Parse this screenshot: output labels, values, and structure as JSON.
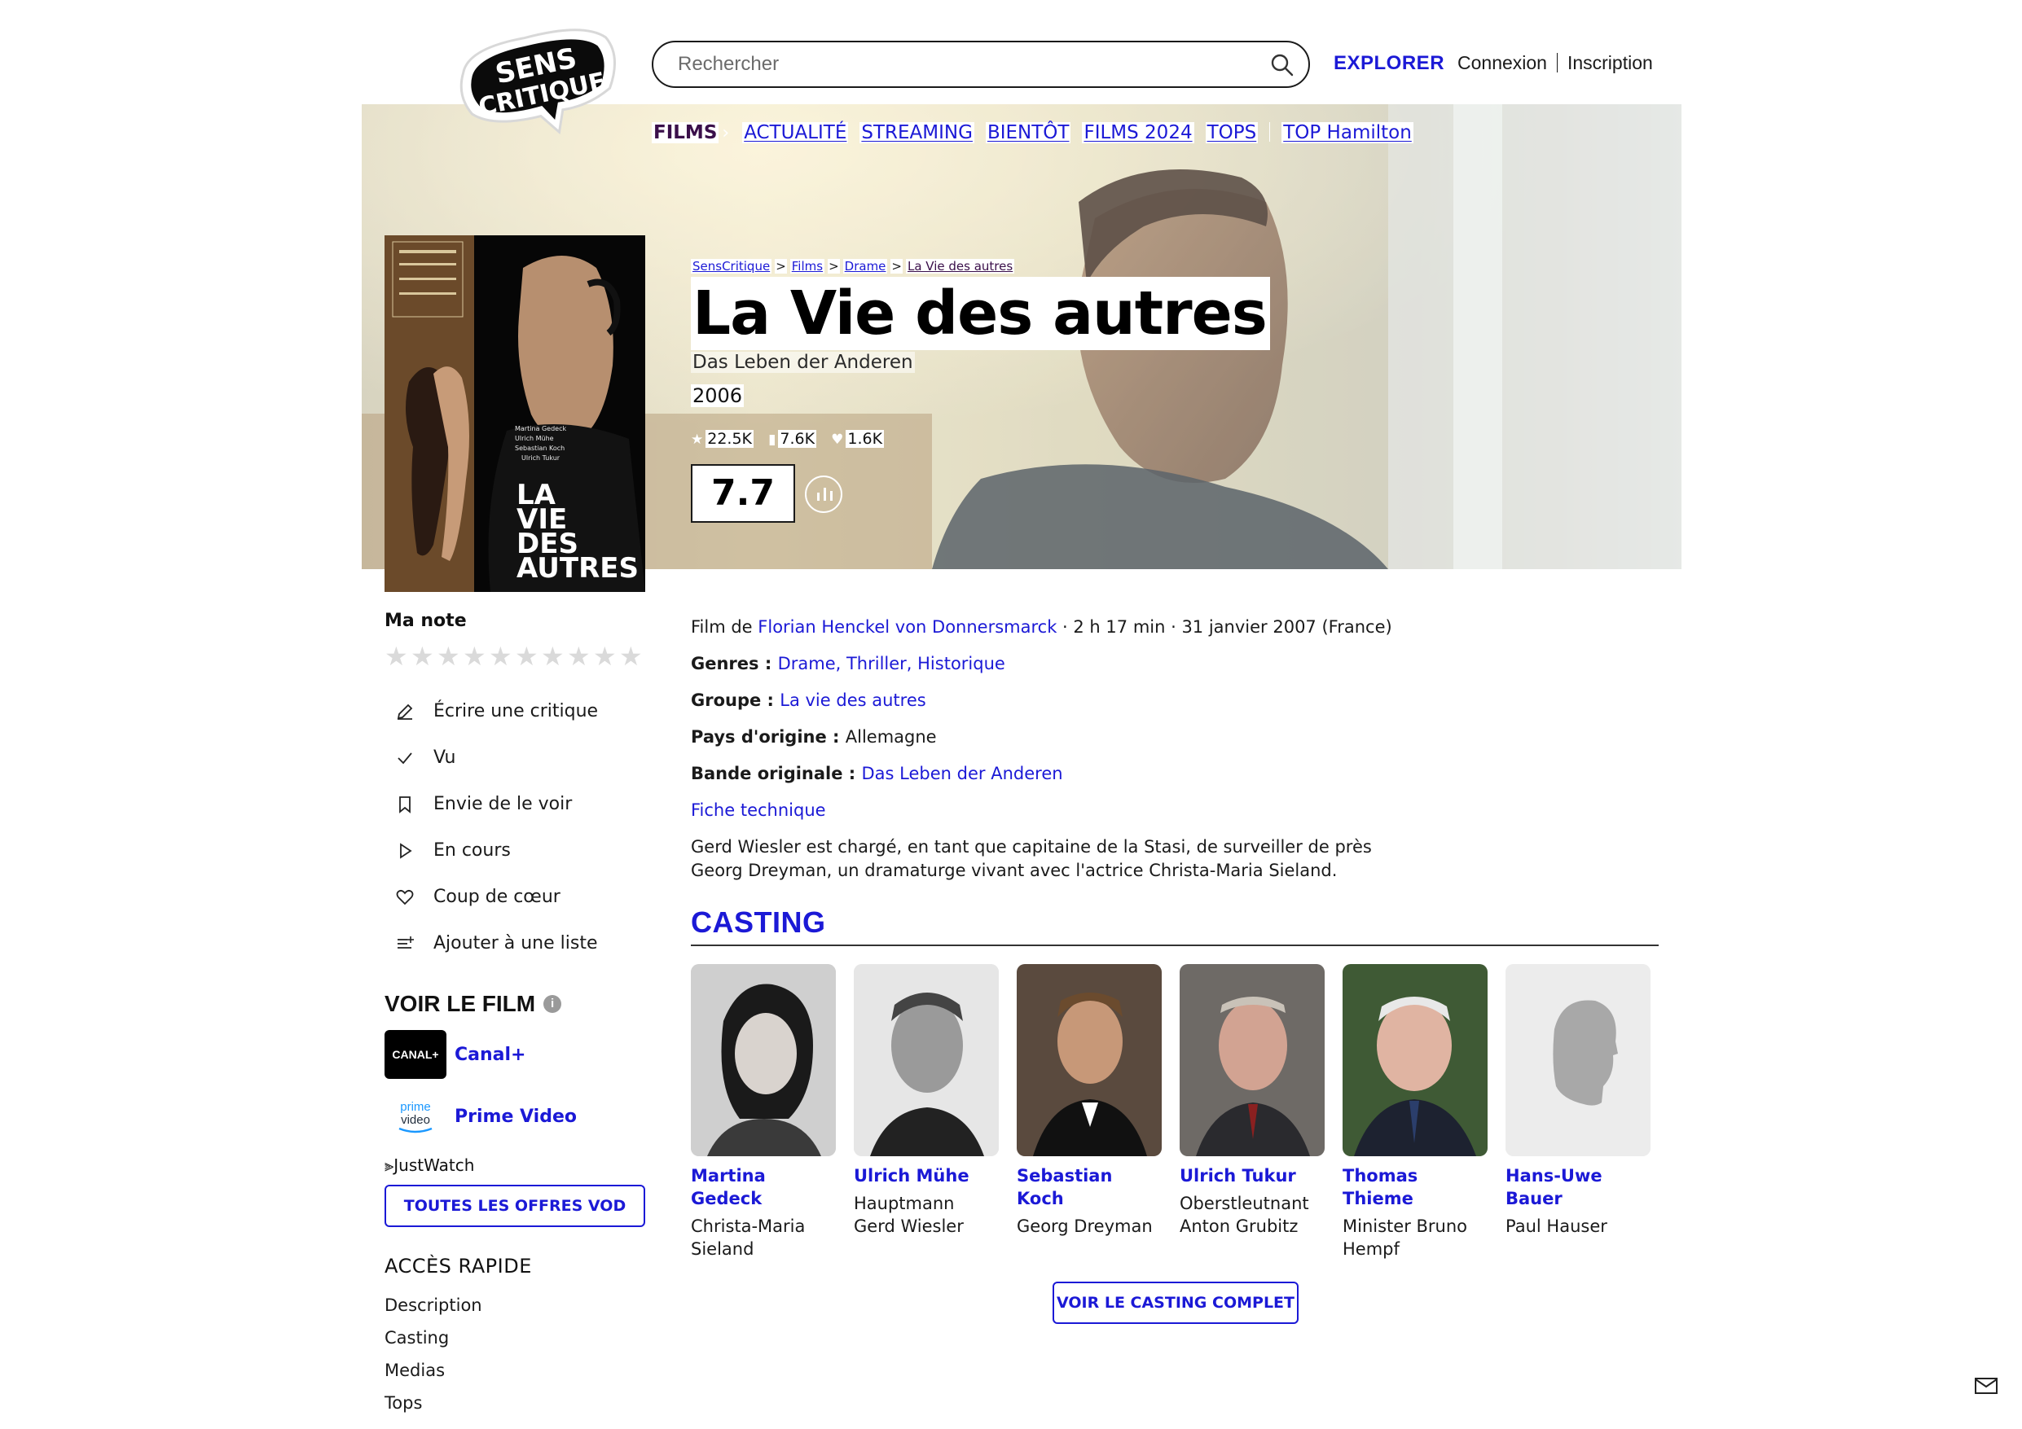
{
  "header": {
    "search_placeholder": "Rechercher",
    "explorer_label": "EXPLORER",
    "login_label": "Connexion",
    "signup_label": "Inscription",
    "logo_text": "SENS CRITIQUE"
  },
  "subnav": {
    "films": "FILMS",
    "items": [
      "ACTUALITÉ",
      "STREAMING",
      "BIENTÔT",
      "FILMS 2024",
      "TOPS"
    ],
    "extra": "TOP Hamilton"
  },
  "breadcrumb": [
    "SensCritique",
    "Films",
    "Drame",
    "La Vie des autres"
  ],
  "movie": {
    "title": "La Vie des autres",
    "original_title": "Das Leben der Anderen",
    "year": "2006",
    "ratings_count": "22.5K",
    "wishlist_count": "7.6K",
    "likes_count": "1.6K",
    "score": "7.7",
    "poster_text": [
      "LA",
      "VIE",
      "DES",
      "AUTRES"
    ]
  },
  "sidebar": {
    "my_rating_label": "Ma note",
    "actions": [
      {
        "icon": "pencil-icon",
        "label": "Écrire une critique"
      },
      {
        "icon": "check-icon",
        "label": "Vu"
      },
      {
        "icon": "bookmark-icon",
        "label": "Envie de le voir"
      },
      {
        "icon": "play-icon",
        "label": "En cours"
      },
      {
        "icon": "heart-icon",
        "label": "Coup de cœur"
      },
      {
        "icon": "add-list-icon",
        "label": "Ajouter à une liste"
      }
    ],
    "watch_title": "VOIR LE FILM",
    "providers": [
      {
        "name": "Canal+",
        "logo_text": "CANAL+"
      },
      {
        "name": "Prime Video",
        "logo_text": "prime video"
      }
    ],
    "justwatch": "JustWatch",
    "vod_button": "TOUTES LES OFFRES VOD",
    "quick_access_title": "ACCÈS RAPIDE",
    "quick_access": [
      "Description",
      "Casting",
      "Medias",
      "Tops"
    ]
  },
  "info": {
    "film_by_prefix": "Film de ",
    "director": "Florian Henckel von Donnersmarck",
    "meta": " · 2 h 17 min · 31 janvier 2007 (France)",
    "genres_label": "Genres : ",
    "genres": "Drame, Thriller, Historique",
    "group_label": "Groupe : ",
    "group": "La vie des autres",
    "country_label": "Pays d'origine : ",
    "country": "Allemagne",
    "original_label": "Bande originale : ",
    "original": "Das Leben der Anderen",
    "tech_sheet": "Fiche technique",
    "synopsis": "Gerd Wiesler est chargé, en tant que capitaine de la Stasi, de surveiller de près Georg Dreyman, un dramaturge vivant avec l'actrice Christa-Maria Sieland."
  },
  "casting": {
    "title": "CASTING",
    "members": [
      {
        "name": "Martina Gedeck",
        "role": "Christa-Maria Sieland"
      },
      {
        "name": "Ulrich Mühe",
        "role": "Hauptmann Gerd Wiesler"
      },
      {
        "name": "Sebastian Koch",
        "role": "Georg Dreyman"
      },
      {
        "name": "Ulrich Tukur",
        "role": "Oberstleutnant Anton Grubitz"
      },
      {
        "name": "Thomas Thieme",
        "role": "Minister Bruno Hempf"
      },
      {
        "name": "Hans-Uwe Bauer",
        "role": "Paul Hauser"
      }
    ],
    "full_button": "VOIR LE CASTING COMPLET"
  },
  "colors": {
    "accent": "#1b19d6",
    "films_nav": "#3a0f4a",
    "text": "#1a1a1a"
  }
}
